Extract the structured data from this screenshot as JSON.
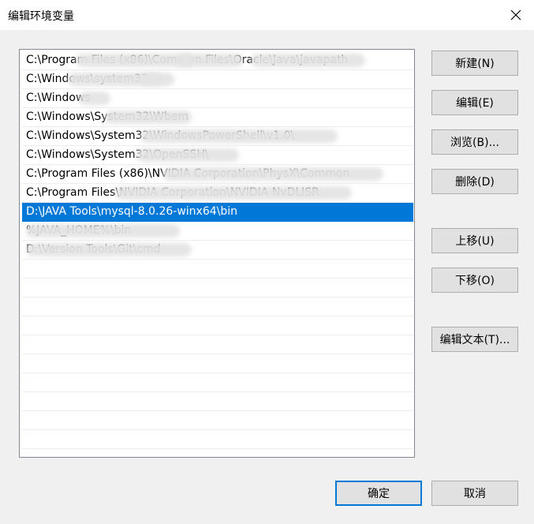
{
  "window": {
    "title": "编辑环境变量",
    "close_icon": "close-icon"
  },
  "paths": [
    {
      "text": "C:\\Program Files (x86)\\Common Files\\Oracle\\Java\\javapath"
    },
    {
      "text": "C:\\Windows\\system32"
    },
    {
      "text": "C:\\Windows"
    },
    {
      "text": "C:\\Windows\\System32\\Wbem"
    },
    {
      "text": "C:\\Windows\\System32\\WindowsPowerShell\\v1.0\\"
    },
    {
      "text": "C:\\Windows\\System32\\OpenSSH\\"
    },
    {
      "text": "C:\\Program Files (x86)\\NVIDIA Corporation\\PhysX\\Common"
    },
    {
      "text": "C:\\Program Files\\NVIDIA Corporation\\NVIDIA NvDLISR"
    },
    {
      "text": "D:\\JAVA Tools\\mysql-8.0.26-winx64\\bin",
      "selected": true
    },
    {
      "text": "%JAVA_HOME%\\bin"
    },
    {
      "text": "D:\\Version Tools\\Git\\cmd"
    }
  ],
  "buttons": {
    "new": "新建(N)",
    "edit": "编辑(E)",
    "browse": "浏览(B)...",
    "delete": "删除(D)",
    "move_up": "上移(U)",
    "move_down": "下移(O)",
    "edit_text": "编辑文本(T)...",
    "ok": "确定",
    "cancel": "取消"
  },
  "colors": {
    "selection": "#0078d7",
    "focus_border": "#0078d7"
  }
}
